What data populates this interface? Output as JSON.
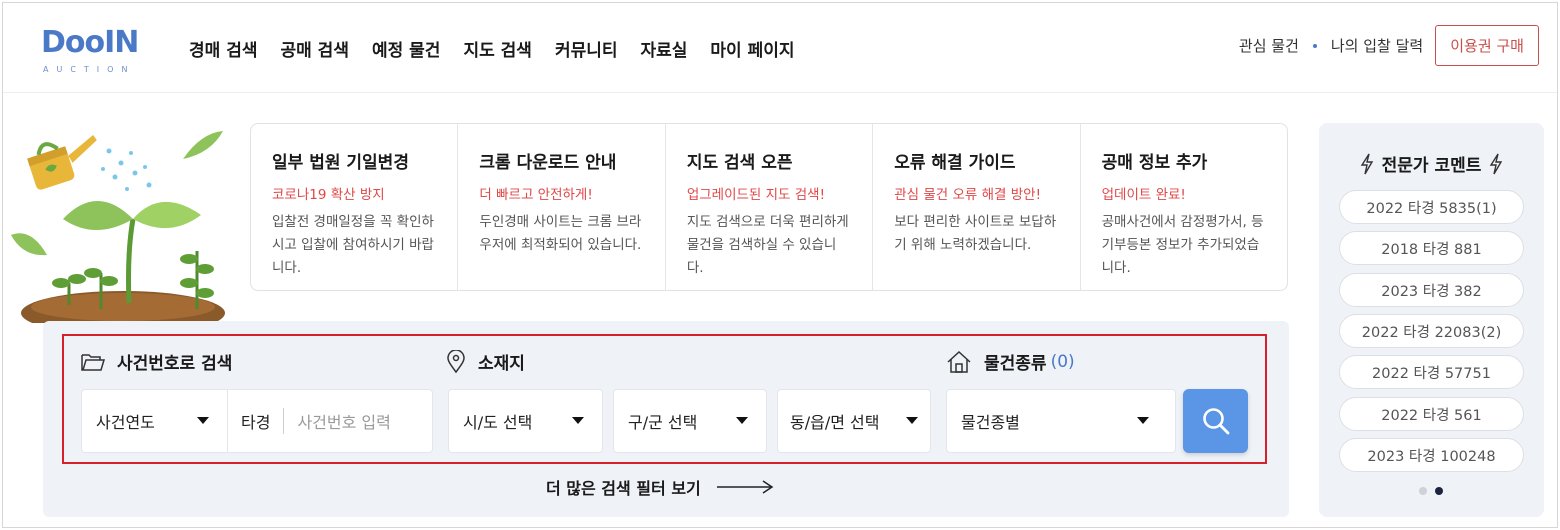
{
  "header": {
    "logo_text": "DooIN",
    "logo_sub": "AUCTION",
    "nav": [
      "경매 검색",
      "공매 검색",
      "예정 물건",
      "지도 검색",
      "커뮤니티",
      "자료실",
      "마이 페이지"
    ],
    "interest_link": "관심 물건",
    "calendar_link": "나의 입찰 달력",
    "buy_button": "이용권 구매"
  },
  "notices": [
    {
      "title": "일부 법원 기일변경",
      "subtitle": "코로나19 확산 방지",
      "desc": "입찰전 경매일정을 꼭 확인하시고 입찰에 참여하시기 바랍니다."
    },
    {
      "title": "크롬 다운로드 안내",
      "subtitle": "더 빠르고 안전하게!",
      "desc": "두인경매 사이트는 크롬 브라우저에 최적화되어 있습니다."
    },
    {
      "title": "지도 검색 오픈",
      "subtitle": "업그레이드된 지도 검색!",
      "desc": "지도 검색으로 더욱 편리하게 물건을 검색하실 수 있습니다."
    },
    {
      "title": "오류 해결 가이드",
      "subtitle": "관심 물건 오류 해결 방안!",
      "desc": "보다 편리한 사이트로 보답하기 위해 노력하겠습니다."
    },
    {
      "title": "공매 정보 추가",
      "subtitle": "업데이트 완료!",
      "desc": "공매사건에서 감정평가서, 등기부등본 정보가 추가되었습니다."
    }
  ],
  "search": {
    "case_label": "사건번호로 검색",
    "location_label": "소재지",
    "type_label": "물건종류",
    "type_count": "(0)",
    "year_select": "사건연도",
    "case_type": "타경",
    "case_placeholder": "사건번호 입력",
    "sido_select": "시/도 선택",
    "gugun_select": "구/군 선택",
    "dong_select": "동/읍/면 선택",
    "item_select": "물건종별",
    "more_filters": "더 많은 검색 필터 보기"
  },
  "expert": {
    "title": "전문가 코멘트",
    "items": [
      "2022 타경 5835(1)",
      "2018 타경 881",
      "2023 타경 382",
      "2022 타경 22083(2)",
      "2022 타경 57751",
      "2022 타경 561",
      "2023 타경 100248"
    ]
  },
  "colors": {
    "brand": "#4a79c8",
    "accent_red": "#e04848",
    "search_button": "#5a95e6",
    "panel_bg": "#eff2f7"
  }
}
